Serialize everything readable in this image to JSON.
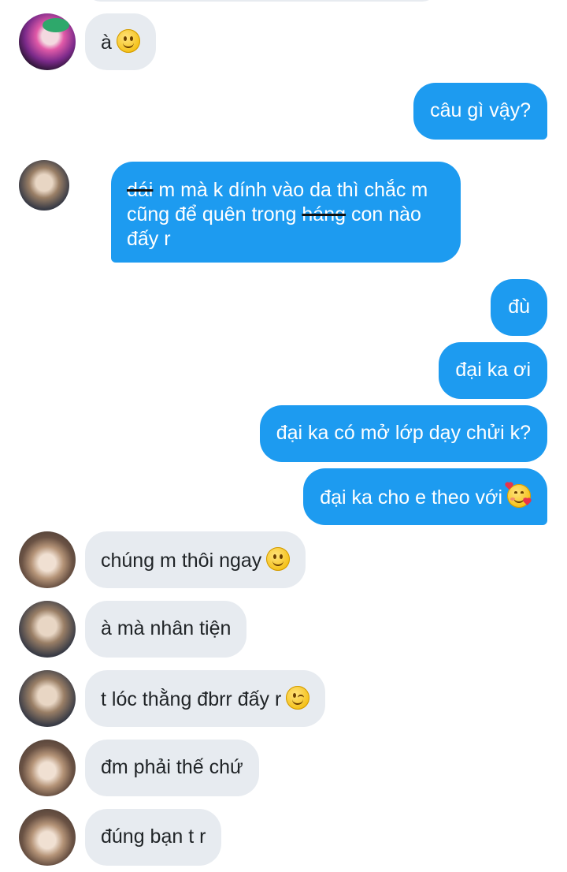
{
  "messages": [
    {
      "side": "in",
      "text": "à",
      "emoji": "slightly-smiling-face-emoji"
    },
    {
      "side": "out",
      "text": "câu gì vậy?"
    },
    {
      "side": "out",
      "text_strike_1": "dái",
      "text_1": " m mà k dính vào da thì chắc m",
      "text_2": "cũng để quên trong ",
      "text_strike_2": "háng",
      "text_3": " con nào",
      "text_4": "đấy r"
    },
    {
      "side": "out",
      "text": "đù"
    },
    {
      "side": "out",
      "text": "đại ka ơi"
    },
    {
      "side": "out",
      "text": "đại ka có mở lớp dạy chửi k?"
    },
    {
      "side": "out",
      "text": "đại ka cho e theo với",
      "emoji": "smiling-face-with-hearts-emoji"
    },
    {
      "side": "in",
      "text": "chúng m thôi ngay",
      "emoji": "slightly-smiling-face-emoji"
    },
    {
      "side": "in",
      "text": "à mà nhân tiện"
    },
    {
      "side": "in",
      "text": "t lóc thằng đbrr đấy r",
      "emoji": "winking-face-emoji"
    },
    {
      "side": "in",
      "text": "đm phải thế chứ"
    },
    {
      "side": "in",
      "text": "đúng bạn t r"
    }
  ],
  "colors": {
    "outgoing_bubble": "#1d9bf0",
    "incoming_bubble": "#e7ebf0",
    "outgoing_text": "#ffffff",
    "incoming_text": "#1f2326"
  }
}
